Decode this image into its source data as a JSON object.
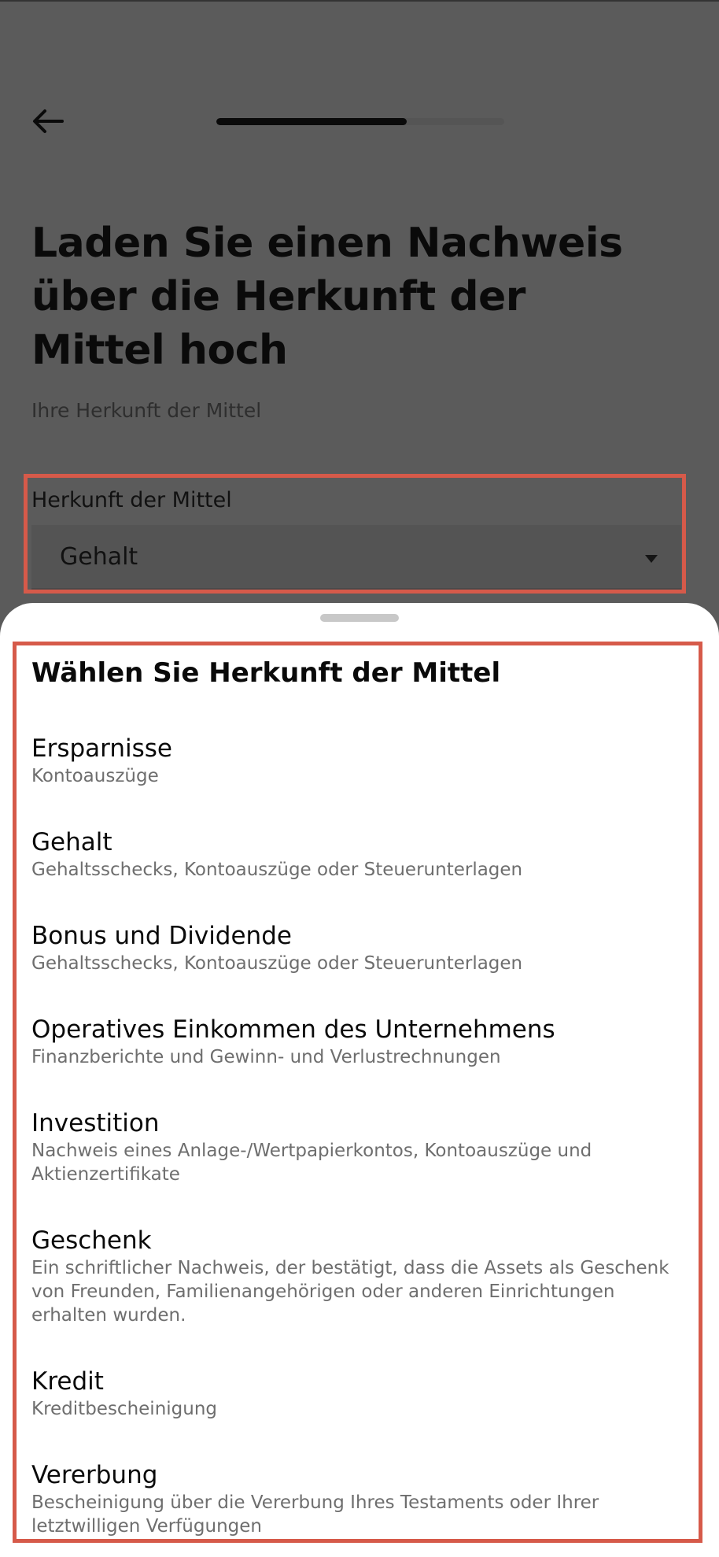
{
  "header": {
    "back_icon": "arrow-left-icon",
    "progress_fraction": 0.66
  },
  "page": {
    "title": "Laden Sie einen Nachweis über die Herkunft der Mittel hoch",
    "subtitle": "Ihre Herkunft der Mittel"
  },
  "field": {
    "label": "Herkunft der Mittel",
    "value": "Gehalt",
    "arrow_icon": "dropdown-arrow-icon"
  },
  "sheet": {
    "title": "Wählen Sie Herkunft der Mittel",
    "options": [
      {
        "title": "Ersparnisse",
        "desc": "Kontoauszüge"
      },
      {
        "title": "Gehalt",
        "desc": "Gehaltsschecks, Kontoauszüge oder Steuerunterlagen"
      },
      {
        "title": "Bonus und Dividende",
        "desc": "Gehaltsschecks, Kontoauszüge oder Steuerunterlagen"
      },
      {
        "title": "Operatives Einkommen des Unternehmens",
        "desc": "Finanzberichte und Gewinn- und Verlustrechnungen"
      },
      {
        "title": "Investition",
        "desc": "Nachweis eines Anlage-/Wertpapierkontos, Kontoauszüge und Aktienzertifikate"
      },
      {
        "title": "Geschenk",
        "desc": "Ein schriftlicher Nachweis, der bestätigt, dass die Assets als Geschenk von Freunden, Familienangehörigen oder anderen Einrichtungen erhalten wurden."
      },
      {
        "title": "Kredit",
        "desc": "Kreditbescheinigung"
      },
      {
        "title": "Vererbung",
        "desc": "Bescheinigung über die Vererbung Ihres Testaments oder Ihrer letztwilligen Verfügungen"
      }
    ]
  },
  "colors": {
    "overlay": "#5b5b5b",
    "highlight": "#d65a4a",
    "sheet_bg": "#ffffff",
    "desc_text": "#6e6e6e"
  }
}
